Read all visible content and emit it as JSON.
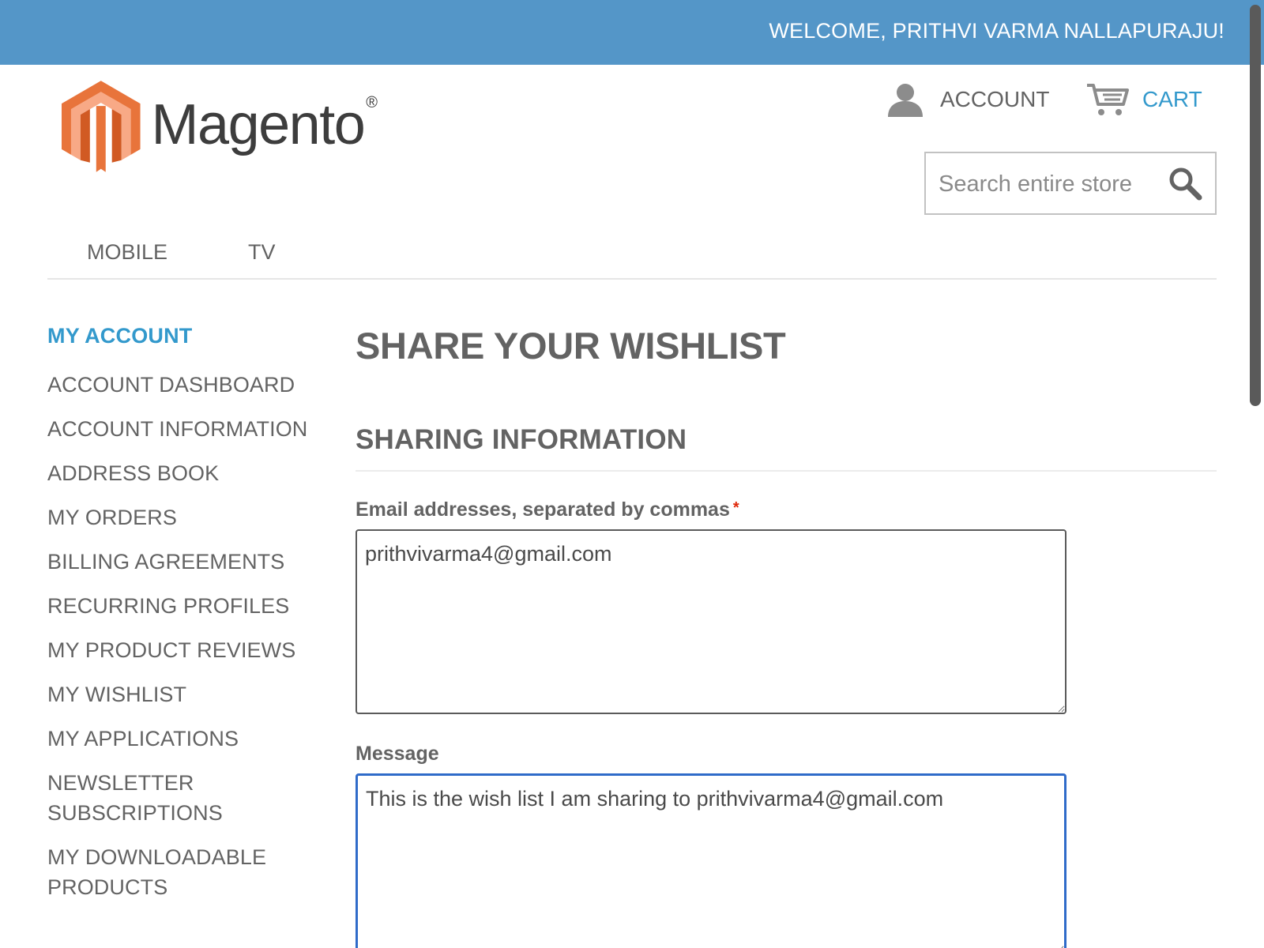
{
  "header": {
    "welcome": "WELCOME, PRITHVI VARMA NALLAPURAJU!",
    "logo": {
      "word": "Magento",
      "mark": "®",
      "icon": "magento-logo-icon"
    },
    "account_label": "ACCOUNT",
    "cart_label": "CART",
    "search": {
      "placeholder": "Search entire store",
      "value": ""
    }
  },
  "nav": {
    "items": [
      "MOBILE",
      "TV"
    ]
  },
  "sidebar": {
    "title": "MY ACCOUNT",
    "items": [
      "ACCOUNT DASHBOARD",
      "ACCOUNT INFORMATION",
      "ADDRESS BOOK",
      "MY ORDERS",
      "BILLING AGREEMENTS",
      "RECURRING PROFILES",
      "MY PRODUCT REVIEWS",
      "MY WISHLIST",
      "MY APPLICATIONS",
      "NEWSLETTER SUBSCRIPTIONS",
      "MY DOWNLOADABLE PRODUCTS"
    ]
  },
  "main": {
    "title": "SHARE YOUR WISHLIST",
    "section_title": "SHARING INFORMATION",
    "email_label": "Email addresses, separated by commas",
    "required_mark": "*",
    "email_value": "prithvivarma4@gmail.com",
    "message_label": "Message",
    "message_value": "This is the wish list I am sharing to prithvivarma4@gmail.com"
  },
  "colors": {
    "welcome_bar": "#5496c8",
    "accent": "#3399cc",
    "logo_orange": "#e8743b",
    "focus_border": "#2f6bc9",
    "required": "#df280a"
  }
}
